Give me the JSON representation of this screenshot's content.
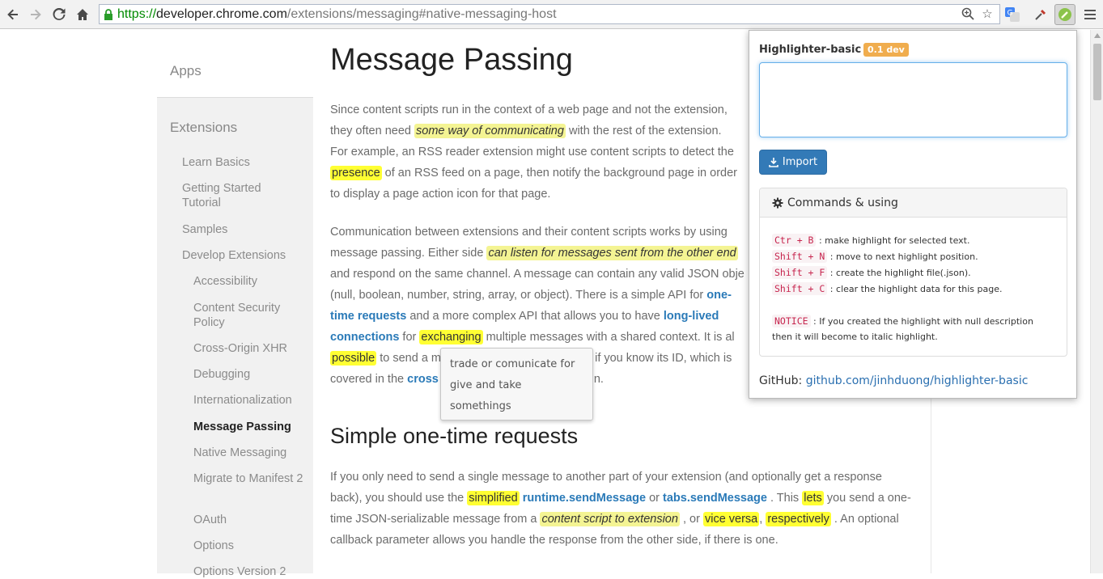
{
  "browser": {
    "url_scheme": "https://",
    "url_host": "developer.chrome.com",
    "url_path": "/extensions/messaging#native-messaging-host"
  },
  "sidebar": {
    "apps_label": "Apps",
    "extensions_label": "Extensions",
    "items": [
      {
        "label": "Learn Basics",
        "level": 1
      },
      {
        "label": "Getting Started Tutorial",
        "level": 1
      },
      {
        "label": "Samples",
        "level": 1
      },
      {
        "label": "Develop Extensions",
        "level": 1
      },
      {
        "label": "Accessibility",
        "level": 2
      },
      {
        "label": "Content Security Policy",
        "level": 2
      },
      {
        "label": "Cross-Origin XHR",
        "level": 2
      },
      {
        "label": "Debugging",
        "level": 2
      },
      {
        "label": "Internationalization",
        "level": 2
      },
      {
        "label": "Message Passing",
        "level": 2,
        "active": true
      },
      {
        "label": "Native Messaging",
        "level": 2
      },
      {
        "label": "Migrate to Manifest 2",
        "level": 2
      },
      {
        "label": "OAuth",
        "level": 2
      },
      {
        "label": "Options",
        "level": 2
      },
      {
        "label": "Options Version 2",
        "level": 2
      }
    ]
  },
  "article": {
    "title": "Message Passing",
    "p1": {
      "l1": "Since content scripts run in the context of a web page and not the extension,",
      "l2a": "they often need ",
      "l2_hl": "some way of communicating",
      "l2b": " with the rest of the extension.",
      "l3": "For example, an RSS reader extension might use content scripts to detect the",
      "l4_hl": "presence",
      "l4b": " of an RSS feed on a page, then notify the background page in order",
      "l5": "to display a page action icon for that page."
    },
    "p2": {
      "l1": "Communication between extensions and their content scripts works by using",
      "l2a": "message passing. Either side ",
      "l2_hl": "can listen for messages sent from the other end",
      "l3": "and respond on the same channel. A message can contain any valid JSON obje",
      "l4a": "(null, boolean, number, string, array, or object). There is a simple API for ",
      "l4_link": "one-",
      "l5_link": "time requests",
      "l5b": " and a more complex API that allows you to have ",
      "l5_link2": "long-lived",
      "l6_link": "connections",
      "l6b": " for ",
      "l6_hl": "exchanging",
      "l6c": " multiple messages with a shared context. It is al",
      "l7_hl": "possible",
      "l7b": " to send a m",
      "l7c": "n if you know its ID, which is",
      "l8a": "covered in the ",
      "l8_link": "cross",
      "l8b": "n."
    },
    "tooltip": [
      "trade or comunicate for",
      "give and take",
      "somethings"
    ],
    "h2": "Simple one-time requests",
    "p3": {
      "l1": "If you only need to send a single message to another part of your extension (and optionally get a response",
      "l2a": "back), you should use the ",
      "l2_hl": "simplified",
      "l2_link1": "runtime.sendMessage",
      "l2_or": " or ",
      "l2_link2": "tabs.sendMessage",
      "l2_dot": " . This ",
      "l2_hl2": "lets",
      "l2b": " you send a one-",
      "l3a": "time JSON-serializable message from a ",
      "l3_hl": "content script to extension",
      "l3_comma": " , or ",
      "l3_hl2": "vice versa",
      "l3_comma2": ", ",
      "l3_hl3": "respectively",
      "l3b": " . An optional",
      "l4": "callback parameter allows you handle the response from the other side, if there is one."
    }
  },
  "popup": {
    "title": "Highlighter-basic",
    "badge": "0.1 dev",
    "textarea_value": "",
    "import_label": "Import",
    "commands_title": "Commands & using",
    "commands": [
      {
        "key": "Ctr + B",
        "desc": "make highlight for selected text."
      },
      {
        "key": "Shift + N",
        "desc": "move to next highlight position."
      },
      {
        "key": "Shift + F",
        "desc": "create the highlight file(.json)."
      },
      {
        "key": "Shift + C",
        "desc": "clear the highlight data for this page."
      }
    ],
    "notice_key": "NOTICE",
    "notice_l1": "If you created the highlight with null description",
    "notice_l2": "then it will become to italic highlight.",
    "github_label": "GitHub:",
    "github_link": "github.com/jinhduong/highlighter-basic"
  }
}
